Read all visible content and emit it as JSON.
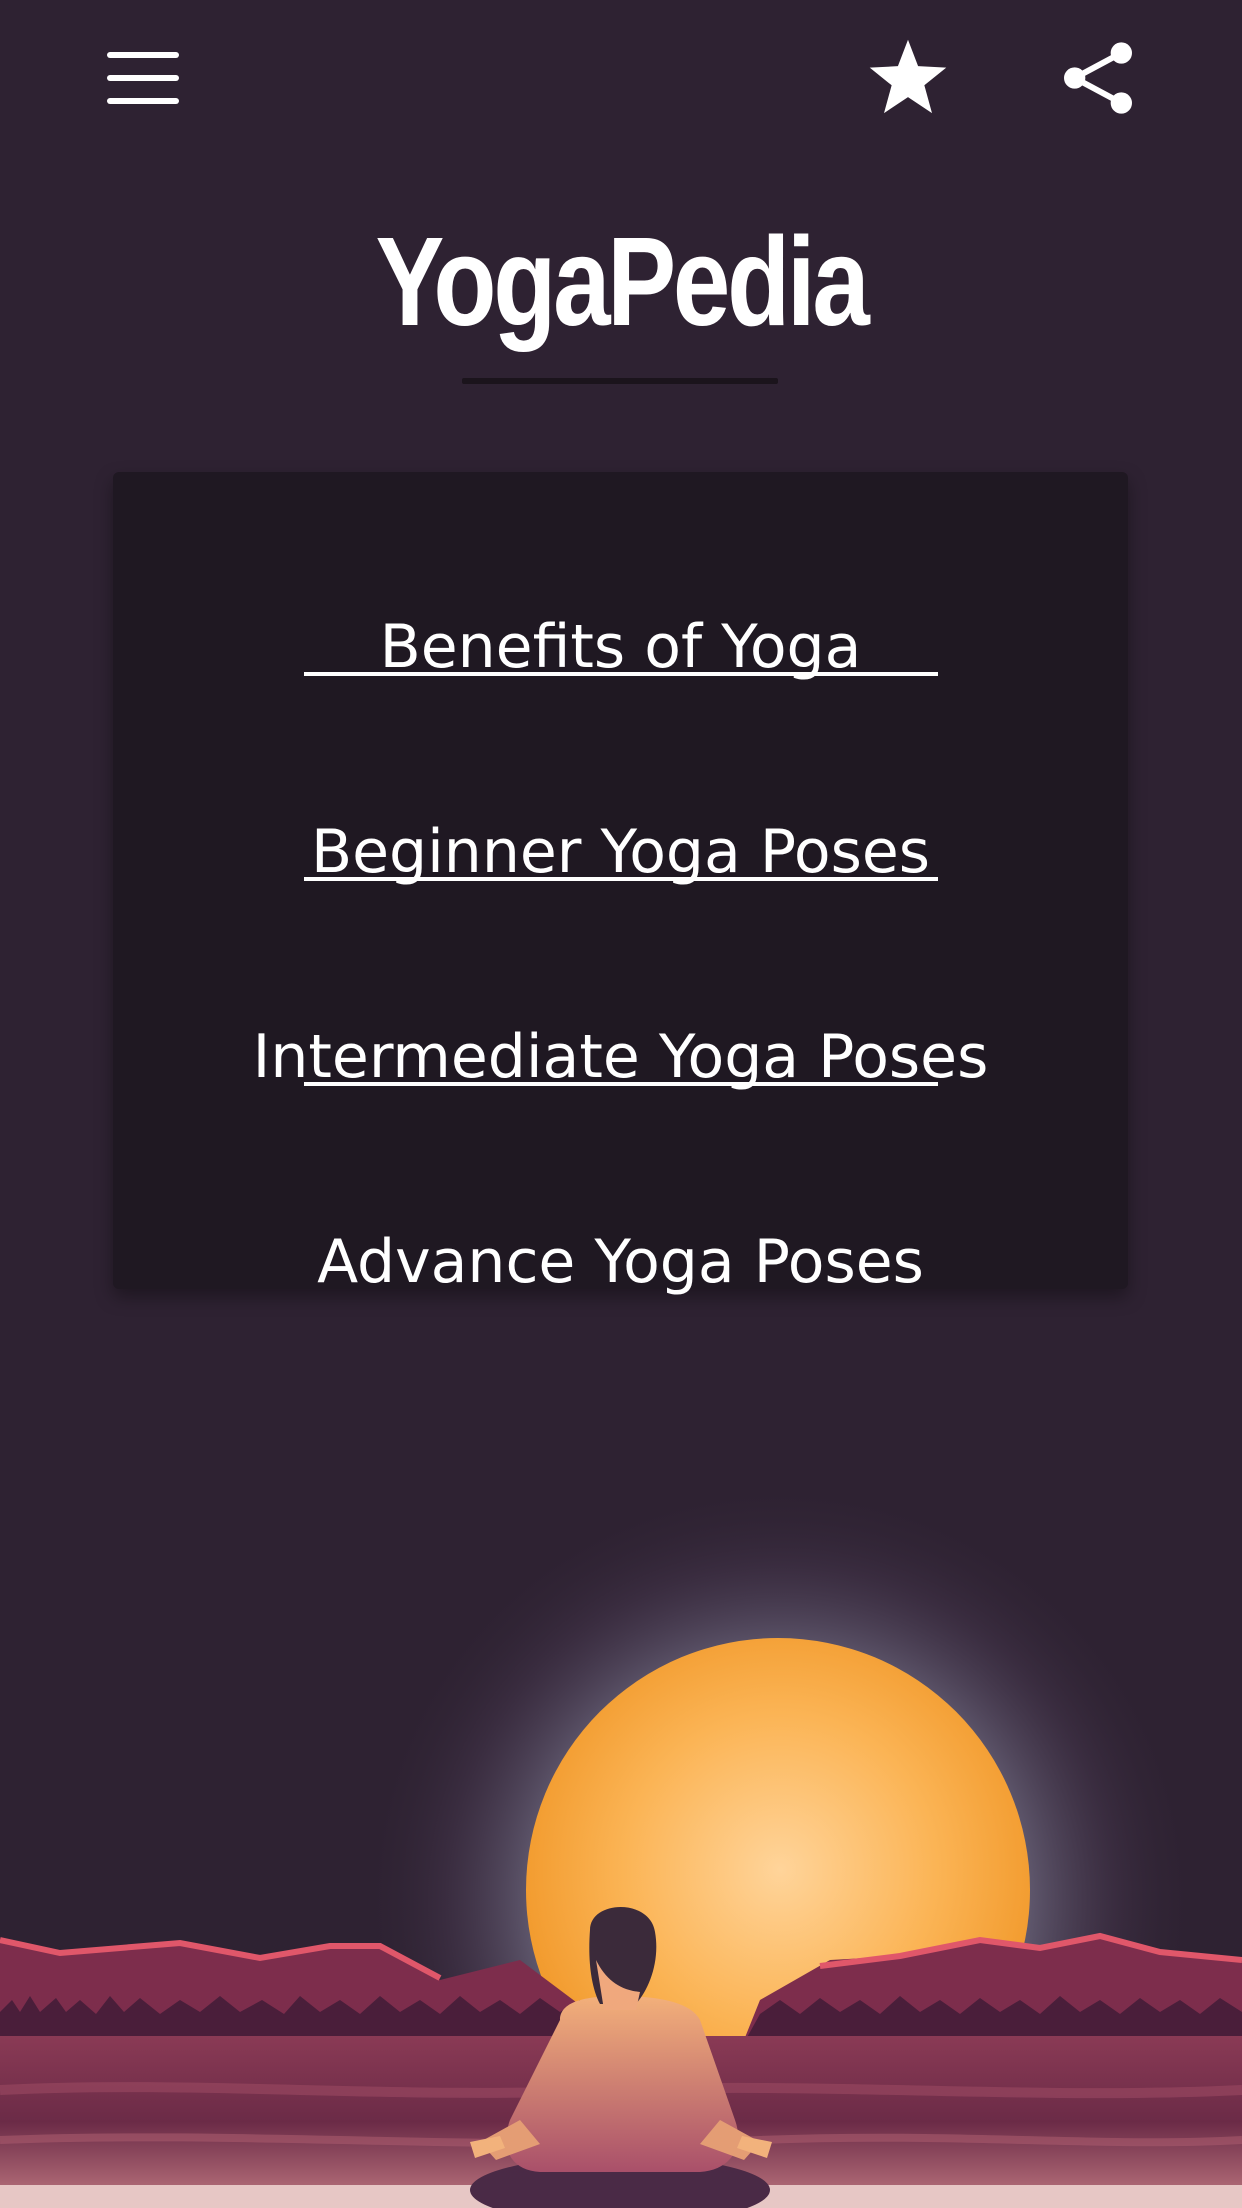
{
  "app": {
    "title": "YogaPedia"
  },
  "toolbar": {
    "menu_icon": "hamburger-menu-icon",
    "favorite_icon": "star-icon",
    "share_icon": "share-icon"
  },
  "menu": {
    "items": [
      {
        "label": "Benefits of Yoga"
      },
      {
        "label": "Beginner Yoga Poses"
      },
      {
        "label": "Intermediate Yoga Poses"
      },
      {
        "label": "Advance Yoga Poses"
      }
    ]
  },
  "colors": {
    "background": "#2e2232",
    "card": "#1f1822",
    "sun": "#f6a73a",
    "mountains": "#7a2a48",
    "text": "#ffffff"
  }
}
